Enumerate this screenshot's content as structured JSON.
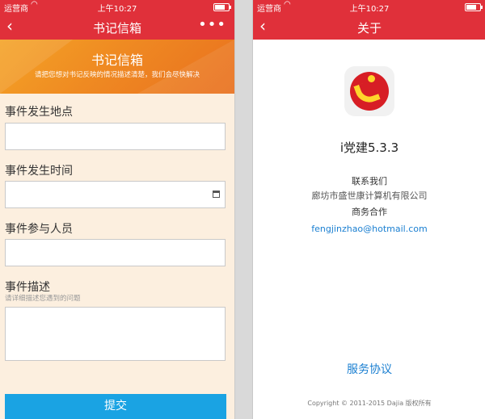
{
  "status_bar": {
    "carrier": "运营商",
    "time": "上午10:27"
  },
  "left_screen": {
    "nav": {
      "title": "书记信箱",
      "back_icon": "‹",
      "more_icon": "•••"
    },
    "banner": {
      "title": "书记信箱",
      "subtitle": "请把您想对书记反映的情况描述清楚，我们会尽快解决"
    },
    "fields": {
      "location_label": "事件发生地点",
      "time_label": "事件发生时间",
      "people_label": "事件参与人员",
      "description_label": "事件描述",
      "description_hint": "请详细描述您遇到的问题"
    },
    "submit_label": "提交"
  },
  "right_screen": {
    "nav": {
      "title": "关于",
      "back_icon": "‹"
    },
    "app_version": "i党建5.3.3",
    "contact_title": "联系我们",
    "company": "廊坊市盛世康计算机有限公司",
    "business_title": "商务合作",
    "email": "fengjinzhao@hotmail.com",
    "agreement_link": "服务协议",
    "copyright": "Copyright © 2011-2015 Dajia 版权所有"
  },
  "colors": {
    "brand_red": "#e0303a",
    "banner_orange": "#ef8a22",
    "submit_blue": "#1aa3e3",
    "link_blue": "#1a7fd1"
  }
}
